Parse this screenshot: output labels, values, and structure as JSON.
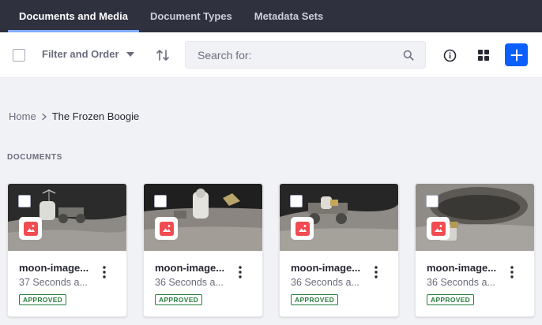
{
  "nav": {
    "tabs": [
      {
        "label": "Documents and Media",
        "active": true
      },
      {
        "label": "Document Types",
        "active": false
      },
      {
        "label": "Metadata Sets",
        "active": false
      }
    ]
  },
  "toolbar": {
    "filter_label": "Filter and Order",
    "search_placeholder": "Search for:",
    "icons": [
      "sort-icon",
      "search-icon",
      "info-icon",
      "grid-view-icon",
      "plus-icon"
    ]
  },
  "breadcrumb": {
    "home": "Home",
    "current": "The Frozen Boogie"
  },
  "section": {
    "title": "DOCUMENTS"
  },
  "cards": [
    {
      "title": "moon-image...",
      "time": "37 Seconds a...",
      "status": "APPROVED"
    },
    {
      "title": "moon-image...",
      "time": "36 Seconds a...",
      "status": "APPROVED"
    },
    {
      "title": "moon-image...",
      "time": "36 Seconds a...",
      "status": "APPROVED"
    },
    {
      "title": "moon-image...",
      "time": "36 Seconds a...",
      "status": "APPROVED"
    }
  ],
  "colors": {
    "nav_bg": "#30313f",
    "accent": "#0b5fff",
    "status_green": "#287d3c",
    "sticker_red": "#f14c52"
  }
}
